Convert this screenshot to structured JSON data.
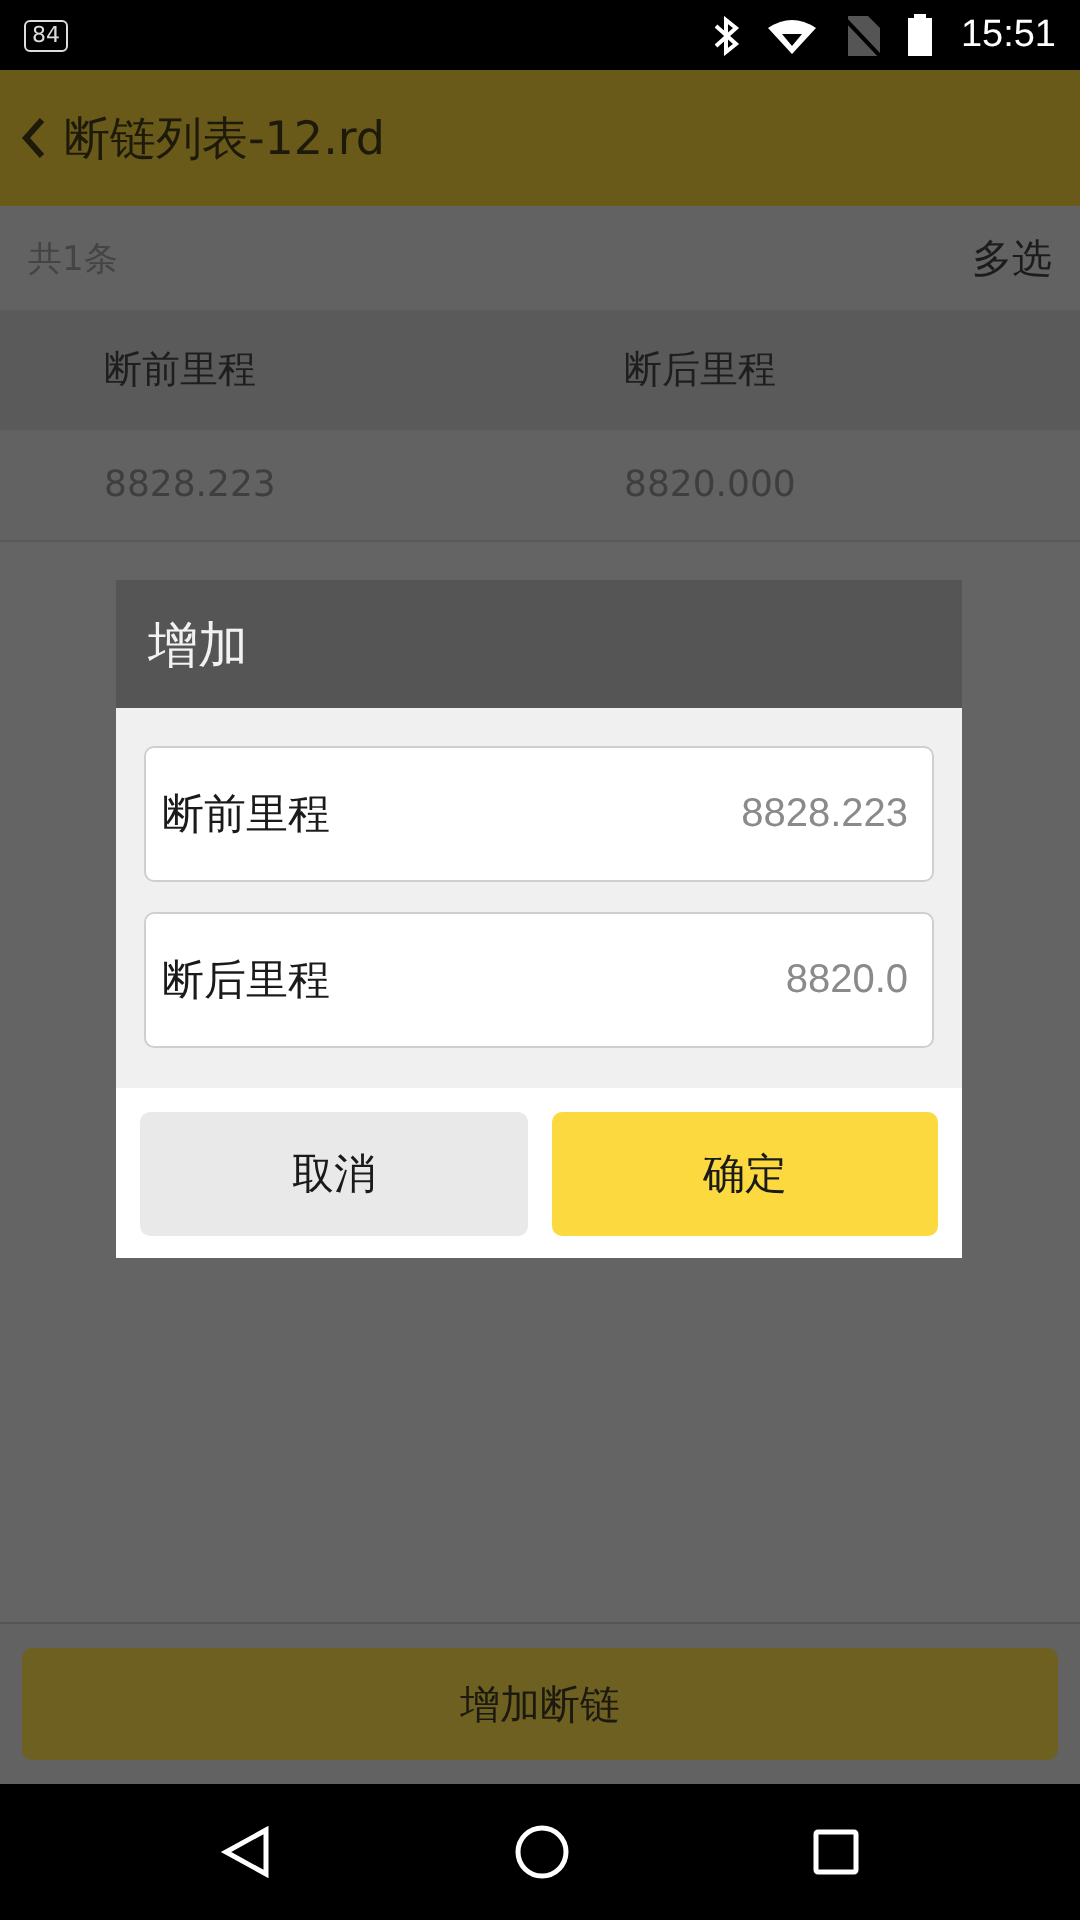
{
  "status_bar": {
    "notification_badge": "84",
    "time": "15:51"
  },
  "app_bar": {
    "title": "断链列表-12.rd"
  },
  "list": {
    "count": "共1条",
    "action": "多选",
    "columns": [
      "断前里程",
      "断后里程"
    ],
    "rows": [
      [
        "8828.223",
        "8820.000"
      ]
    ]
  },
  "dialog": {
    "title": "增加",
    "fields": [
      {
        "label": "断前里程",
        "value": "8828.223"
      },
      {
        "label": "断后里程",
        "value": "8820.0"
      }
    ],
    "buttons": [
      {
        "label": "取消",
        "kind": "cancel"
      },
      {
        "label": "确定",
        "kind": "primary"
      }
    ]
  },
  "bottom_button": "增加断链"
}
